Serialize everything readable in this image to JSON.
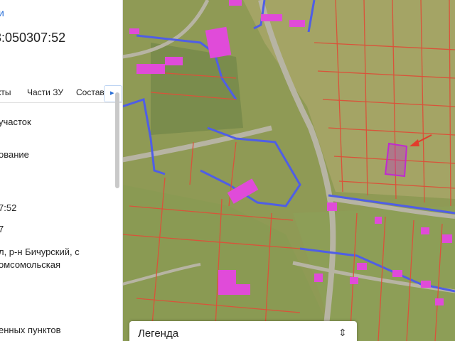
{
  "panel": {
    "link_text": "и",
    "cadastral_number": "3:050307:52",
    "tabs": [
      {
        "label": "кты"
      },
      {
        "label": "Части ЗУ"
      },
      {
        "label": "Состав"
      }
    ],
    "tab_next_glyph": "▸",
    "fields": [
      {
        "text": "участок"
      },
      {
        "text": "ование"
      },
      {
        "text": "7:52"
      },
      {
        "text": "7"
      },
      {
        "text": "л, р-н Бичурский, с"
      },
      {
        "text": "омсомольская"
      },
      {
        "text": "енных пунктов"
      }
    ]
  },
  "legend": {
    "title": "Легенда",
    "toggle_glyph": "⇕"
  },
  "map": {
    "colors": {
      "ground": "#8f9a55",
      "field": "#a4a465",
      "road": "#b7b4a3",
      "parcel_border": "#d9533a",
      "zone_border": "#4f5ee6",
      "building": "#e04bd9",
      "selected_parcel": "#c02ad0",
      "pointer_arrow": "#e23c2c"
    }
  }
}
